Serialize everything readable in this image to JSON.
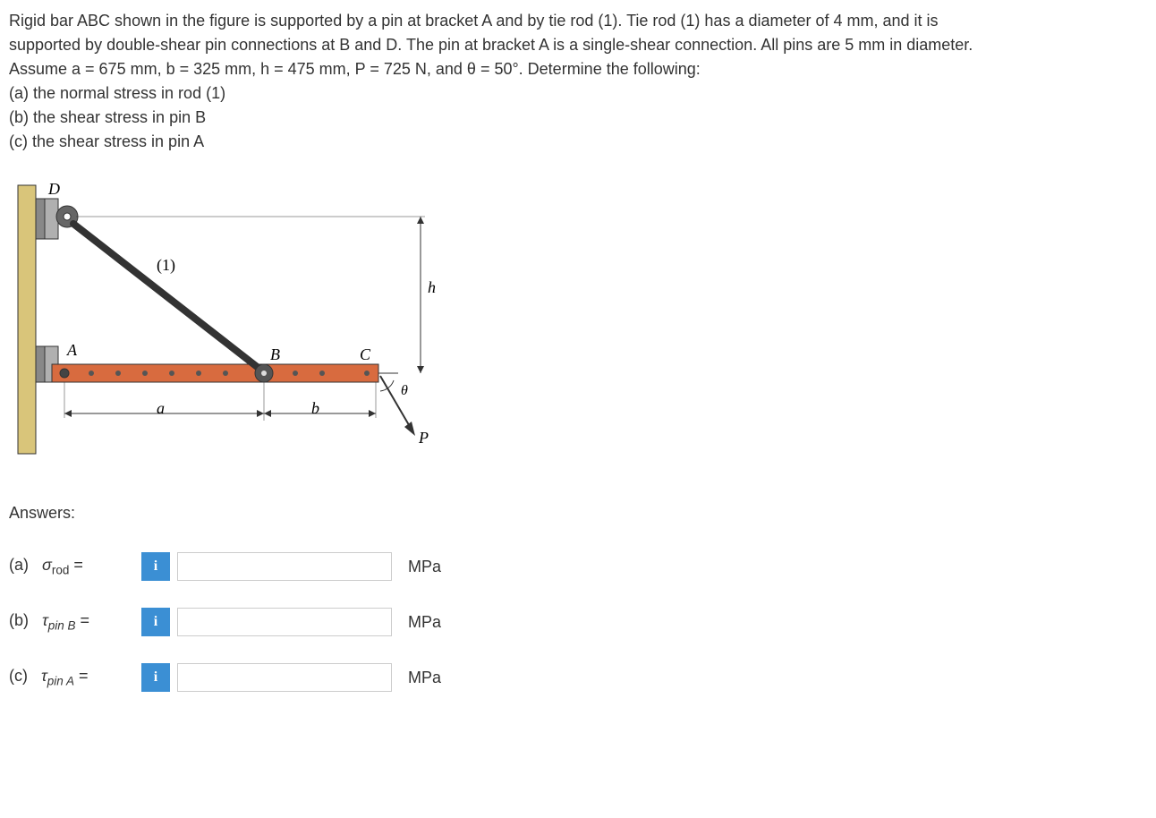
{
  "problem": {
    "line1": "Rigid bar ABC shown in the figure is supported by a pin at bracket A and by tie rod (1). Tie rod (1) has a diameter of 4 mm, and it is",
    "line2": "supported by double-shear pin connections at B and D. The pin at bracket A is a single-shear connection. All pins are 5 mm in diameter.",
    "line3": "Assume a = 675 mm, b = 325 mm, h = 475 mm, P = 725 N, and θ = 50°. Determine the following:",
    "partA": "(a) the normal stress in rod (1)",
    "partB": "(b) the shear stress in pin B",
    "partC": "(c) the shear stress in pin A"
  },
  "figure": {
    "labelD": "D",
    "labelA": "A",
    "labelB": "B",
    "labelC": "C",
    "labelRod": "(1)",
    "labelH": "h",
    "labelA_dim": "a",
    "labelB_dim": "b",
    "labelTheta": "θ",
    "labelP": "P"
  },
  "answers": {
    "heading": "Answers:",
    "a": {
      "prefix": "(a)",
      "symbol_main": "σ",
      "symbol_sub": "rod",
      "eq": " =",
      "unit": "MPa"
    },
    "b": {
      "prefix": "(b)",
      "symbol_main": "τ",
      "symbol_sub": "pin B",
      "eq": " =",
      "unit": "MPa"
    },
    "c": {
      "prefix": "(c)",
      "symbol_main": "τ",
      "symbol_sub": "pin A",
      "eq": " =",
      "unit": "MPa"
    },
    "info_icon": "i"
  }
}
